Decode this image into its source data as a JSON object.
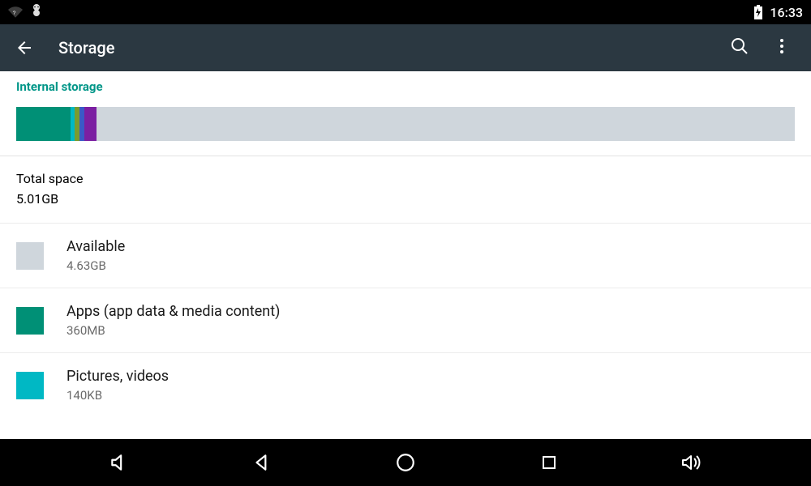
{
  "status": {
    "time": "16:33"
  },
  "appbar": {
    "title": "Storage"
  },
  "section_header": "Internal storage",
  "total": {
    "label": "Total space",
    "value": "5.01GB"
  },
  "rows": {
    "available": {
      "title": "Available",
      "sub": "4.63GB"
    },
    "apps": {
      "title": "Apps (app data & media content)",
      "sub": "360MB"
    },
    "pictures": {
      "title": "Pictures, videos",
      "sub": "140KB"
    }
  }
}
